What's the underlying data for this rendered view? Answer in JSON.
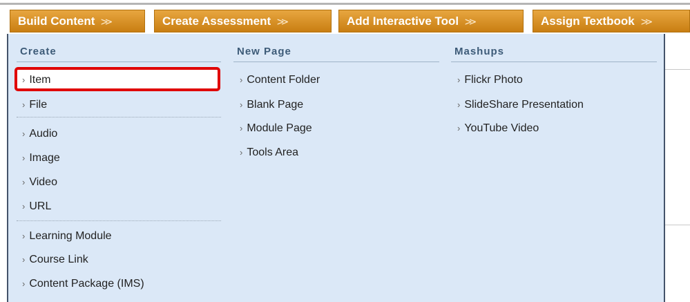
{
  "toolbar": {
    "buttons": [
      {
        "label": "Build Content"
      },
      {
        "label": "Create Assessment"
      },
      {
        "label": "Add Interactive Tool"
      },
      {
        "label": "Assign Textbook"
      }
    ],
    "chevron": "≫"
  },
  "menu": {
    "columns": [
      {
        "heading": "Create",
        "items": [
          {
            "label": "Item",
            "highlighted": true
          },
          {
            "label": "File"
          },
          {
            "label": "Audio"
          },
          {
            "label": "Image"
          },
          {
            "label": "Video"
          },
          {
            "label": "URL"
          },
          {
            "label": "Learning Module"
          },
          {
            "label": "Course Link"
          },
          {
            "label": "Content Package (IMS)"
          }
        ]
      },
      {
        "heading": "New Page",
        "items": [
          {
            "label": "Content Folder"
          },
          {
            "label": "Blank Page"
          },
          {
            "label": "Module Page"
          },
          {
            "label": "Tools Area"
          }
        ]
      },
      {
        "heading": "Mashups",
        "items": [
          {
            "label": "Flickr Photo"
          },
          {
            "label": "SlideShare Presentation"
          },
          {
            "label": "YouTube Video"
          }
        ]
      }
    ],
    "arrow": "›",
    "highlight_color": "#e00000",
    "panel_color": "#dbe8f7",
    "button_color": "#d98f22"
  }
}
